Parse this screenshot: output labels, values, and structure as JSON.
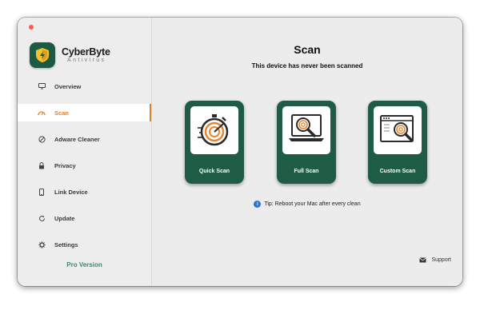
{
  "app": {
    "name": "CyberByte",
    "subtitle": "Antivirus"
  },
  "sidebar": {
    "items": [
      {
        "label": "Overview",
        "icon": "monitor-icon"
      },
      {
        "label": "Scan",
        "icon": "scan-gauge-icon",
        "active": true
      },
      {
        "label": "Adware Cleaner",
        "icon": "block-icon"
      },
      {
        "label": "Privacy",
        "icon": "lock-icon"
      },
      {
        "label": "Link Device",
        "icon": "phone-icon"
      },
      {
        "label": "Update",
        "icon": "refresh-icon"
      },
      {
        "label": "Settings",
        "icon": "gear-icon"
      }
    ],
    "pro_label": "Pro Version"
  },
  "main": {
    "title": "Scan",
    "subtitle": "This device has never been scanned",
    "cards": [
      {
        "label": "Quick Scan",
        "icon": "stopwatch-icon"
      },
      {
        "label": "Full Scan",
        "icon": "laptop-magnifier-icon"
      },
      {
        "label": "Custom Scan",
        "icon": "browser-magnifier-icon"
      }
    ],
    "tip": "Tip: Reboot your Mac after every clean",
    "support_label": "Support"
  },
  "colors": {
    "accent": "#d9822b",
    "card_bg": "#1f5c45",
    "pro": "#3f8a69"
  }
}
